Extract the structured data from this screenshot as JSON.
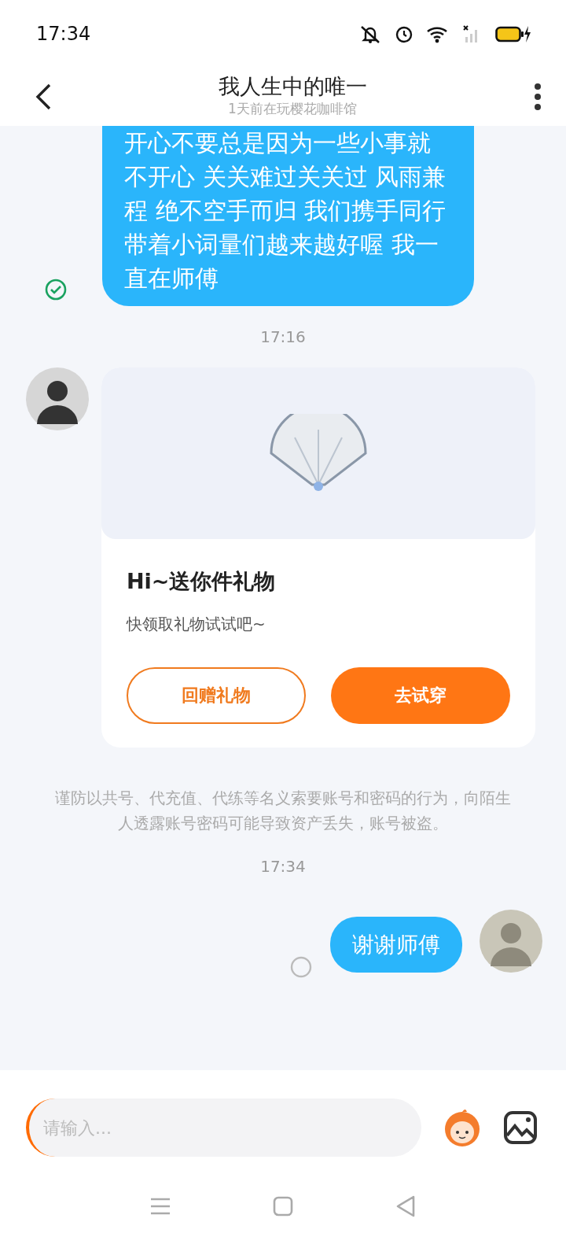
{
  "status_bar": {
    "time": "17:34"
  },
  "header": {
    "title": "我人生中的唯一",
    "subtitle": "1天前在玩樱花咖啡馆"
  },
  "messages": [
    {
      "kind": "text",
      "text": "开心不要总是因为一些小事就不开心 关关难过关关过 风雨兼程 绝不空手而归 我们携手同行带着小词量们越来越好喔 我一直在师傅",
      "read": true,
      "cut_top": true
    },
    {
      "kind": "time",
      "text": "17:16"
    },
    {
      "kind": "gift",
      "title": "Hi~送你件礼物",
      "subtitle": "快领取礼物试试吧~",
      "buttons": [
        {
          "label": "回赠礼物",
          "primary": false
        },
        {
          "label": "去试穿",
          "primary": true
        }
      ]
    },
    {
      "kind": "notice",
      "text": "谨防以共号、代充值、代练等名义索要账号和密码的行为，向陌生人透露账号密码可能导致资产丢失，账号被盗。"
    },
    {
      "kind": "time",
      "text": "17:34"
    },
    {
      "kind": "text",
      "text": "谢谢师傅",
      "read": false,
      "cut_top": false
    }
  ],
  "composer": {
    "placeholder": "请输入..."
  }
}
